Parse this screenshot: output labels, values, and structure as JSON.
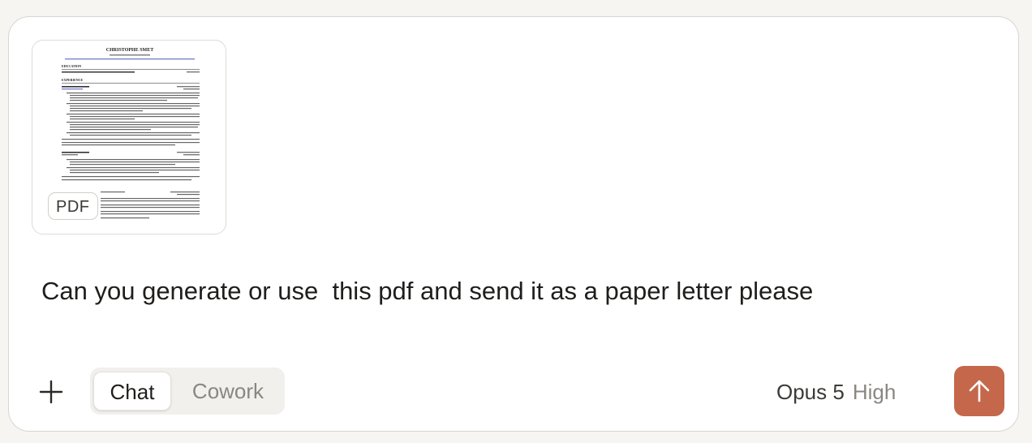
{
  "attachment": {
    "type_label": "PDF",
    "thumbnail": {
      "name": "CHRISTOPHE SMET",
      "sections": [
        "EDUCATION",
        "EXPERIENCE"
      ]
    }
  },
  "message": {
    "text": "Can you generate or use  this pdf and send it as a paper letter please"
  },
  "toolbar": {
    "add_icon": "plus-icon",
    "modes": [
      {
        "label": "Chat",
        "active": true
      },
      {
        "label": "Cowork",
        "active": false
      }
    ],
    "model": {
      "name": "Opus 5",
      "effort": "High"
    },
    "send_icon": "arrow-up-icon"
  },
  "colors": {
    "send_button": "#c4674a",
    "border": "#d9d6cf",
    "toggle_bg": "#f1f0ec"
  }
}
